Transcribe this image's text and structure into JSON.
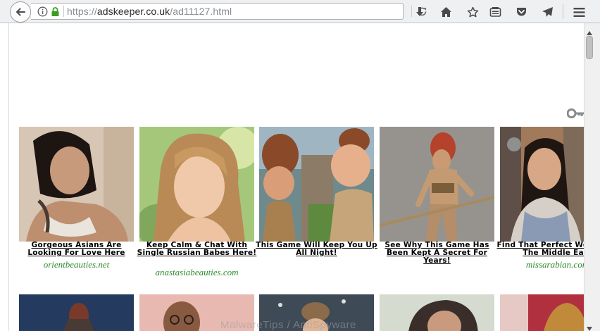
{
  "browser": {
    "url_protocol": "https://",
    "url_host": "adskeeper.co.uk",
    "url_path": "/ad11127.html"
  },
  "ads_row1": [
    {
      "title": "Gorgeous Asians Are Looking For Love Here",
      "source": "orientbeauties.net"
    },
    {
      "title": "Keep Calm & Chat With Single Russian Babes Here!",
      "source": "anastasiabeauties.com"
    },
    {
      "title": "This Game Will Keep You Up All Night!",
      "source": ""
    },
    {
      "title": "See Why This Game Has Been Kept A Secret For Years!",
      "source": ""
    },
    {
      "title": "Find That Perfect Woman In The Middle East",
      "source": "missarabian.com"
    }
  ],
  "watermark": "MalwareTips / AntiSpyware",
  "colors": {
    "source_link": "#2e8b2e",
    "toolbar_bg": "#eef0f2",
    "lock_green": "#3a9d23"
  }
}
